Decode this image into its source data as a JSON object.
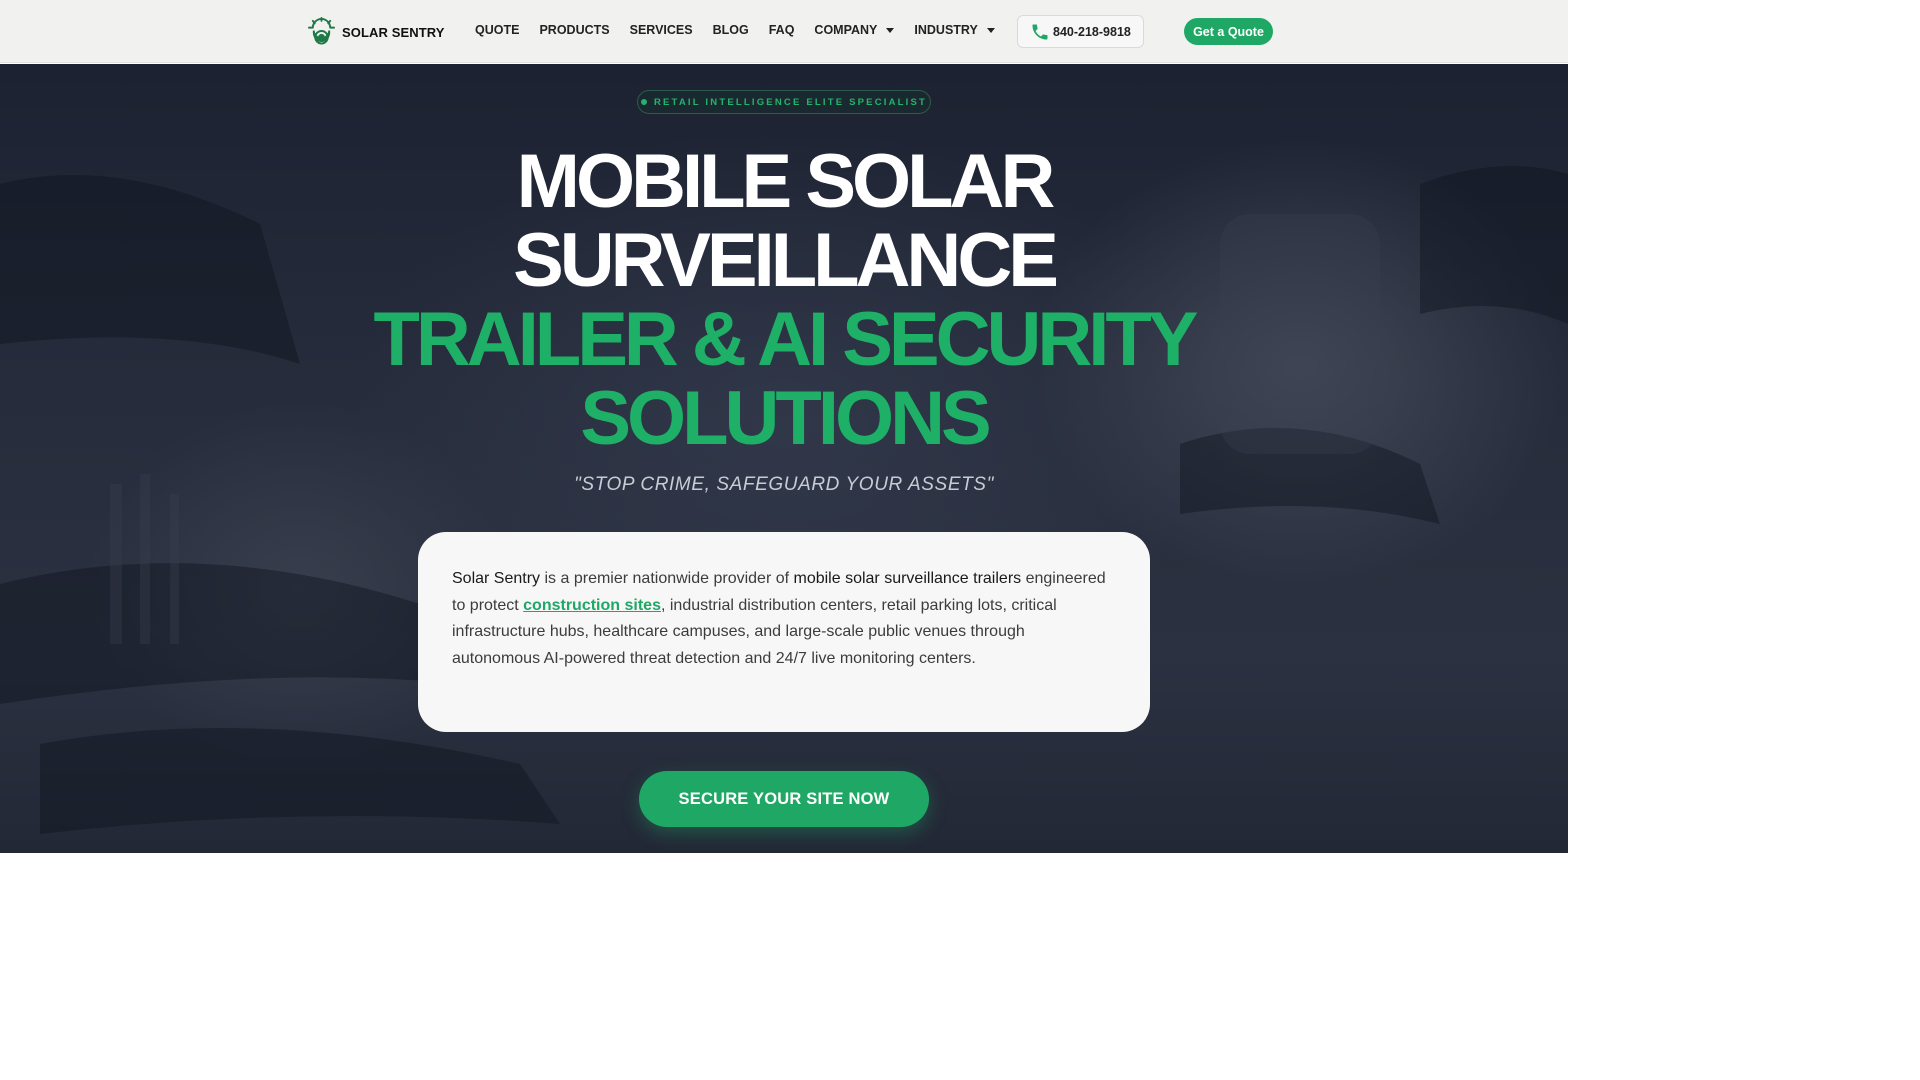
{
  "header": {
    "brand": "SOLAR SENTRY",
    "nav": [
      {
        "label": "QUOTE",
        "dropdown": false
      },
      {
        "label": "PRODUCTS",
        "dropdown": false
      },
      {
        "label": "SERVICES",
        "dropdown": false
      },
      {
        "label": "BLOG",
        "dropdown": false
      },
      {
        "label": "FAQ",
        "dropdown": false
      },
      {
        "label": "COMPANY",
        "dropdown": true
      },
      {
        "label": "INDUSTRY",
        "dropdown": true
      }
    ],
    "phone": "840-218-9818",
    "quote_button": "Get a Quote"
  },
  "hero": {
    "badge": "RETAIL INTELLIGENCE ELITE SPECIALIST",
    "title_line1": "MOBILE SOLAR",
    "title_line2": "SURVEILLANCE",
    "title_line3": "TRAILER & AI SECURITY",
    "title_line4": "SOLUTIONS",
    "tagline": "\"STOP CRIME, SAFEGUARD YOUR ASSETS\"",
    "card": {
      "brand": "Solar Sentry",
      "text1": " is a premier nationwide provider of ",
      "strong": "mobile solar surveillance trailers",
      "text2": " engineered to protect ",
      "link": "construction sites",
      "text3": ", industrial distribution centers, retail parking lots, critical infrastructure hubs, healthcare campuses, and large-scale public venues through autonomous AI-powered threat detection and 24/7 live monitoring centers."
    },
    "cta": "SECURE YOUR SITE NOW"
  },
  "colors": {
    "accent": "#1fa865",
    "hero_bg": "#252b3a",
    "header_bg": "#f1f1f0"
  },
  "icons": [
    "solar-sentry-logo-icon",
    "phone-icon",
    "chevron-down-icon"
  ]
}
